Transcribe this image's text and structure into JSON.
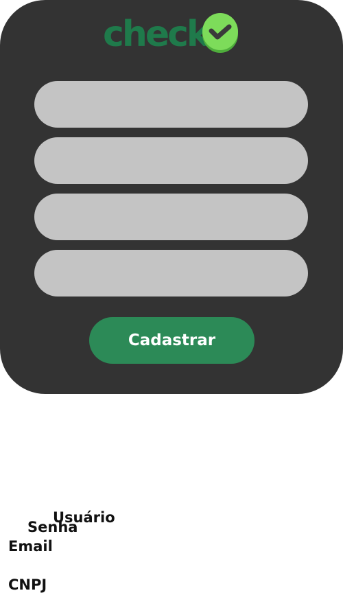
{
  "brand": {
    "logo_text": "check.",
    "logo_color": "#1f7a4b",
    "badge_color": "#7ddc5a",
    "badge_icon": "checkmark-icon"
  },
  "form": {
    "fields": [
      {
        "value": ""
      },
      {
        "value": ""
      },
      {
        "value": ""
      },
      {
        "value": ""
      }
    ],
    "submit_label": "Cadastrar"
  },
  "labels": {
    "usuario": "Usuário",
    "senha": "Senha",
    "email": "Email",
    "cnpj": "CNPJ"
  },
  "colors": {
    "card_background": "#333333",
    "field_background": "#c4c4c4",
    "button_background": "#2c8a57"
  }
}
